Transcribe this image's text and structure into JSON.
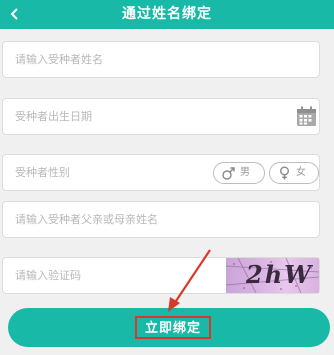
{
  "header": {
    "title": "通过姓名绑定",
    "back_icon": "chevron-left-icon"
  },
  "form": {
    "name_placeholder": "请输入受种者姓名",
    "birthdate_placeholder": "受种者出生日期",
    "calendar_icon": "calendar-icon",
    "gender_label": "受种者性别",
    "gender_options": [
      "男",
      "女"
    ],
    "parent_placeholder": "请输入受种者父亲或母亲姓名",
    "code_placeholder": "请输入验证码",
    "captcha_text": "2hW"
  },
  "submit": {
    "label": "立即绑定"
  },
  "colors": {
    "primary": "#18b9a7",
    "highlight": "#d63a2a"
  },
  "annotation": {
    "icon": "arrow-icon"
  }
}
